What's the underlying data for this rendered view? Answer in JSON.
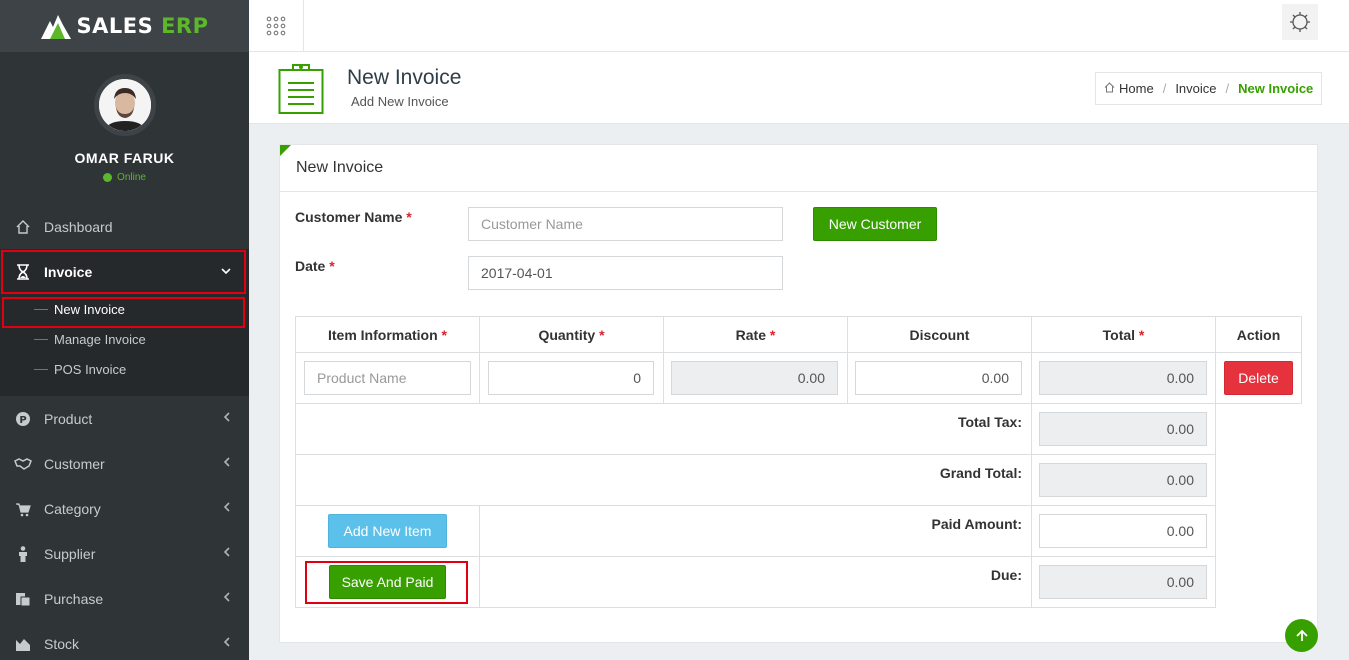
{
  "brand": {
    "name": "SALES",
    "suffix": "ERP"
  },
  "user": {
    "name": "OMAR FARUK",
    "status": "Online"
  },
  "sidebar": {
    "items": [
      {
        "label": "Dashboard",
        "icon": "home-icon"
      },
      {
        "label": "Invoice",
        "icon": "hourglass-icon"
      },
      {
        "label": "Product",
        "icon": "product-icon"
      },
      {
        "label": "Customer",
        "icon": "handshake-icon"
      },
      {
        "label": "Category",
        "icon": "cart-icon"
      },
      {
        "label": "Supplier",
        "icon": "person-icon"
      },
      {
        "label": "Purchase",
        "icon": "purchase-icon"
      },
      {
        "label": "Stock",
        "icon": "chart-icon"
      }
    ],
    "invoice_sub": [
      "New Invoice",
      "Manage Invoice",
      "POS Invoice"
    ]
  },
  "header": {
    "title": "New Invoice",
    "subtitle": "Add New Invoice",
    "breadcrumb": [
      "Home",
      "Invoice",
      "New Invoice"
    ]
  },
  "panel": {
    "title": "New Invoice"
  },
  "form": {
    "customer_label": "Customer Name",
    "customer_placeholder": "Customer Name",
    "new_customer_button": "New Customer",
    "date_label": "Date",
    "date_value": "2017-04-01",
    "required_mark": "*"
  },
  "table": {
    "headers": [
      "Item Information",
      "Quantity",
      "Rate",
      "Discount",
      "Total",
      "Action"
    ],
    "row": {
      "product_placeholder": "Product Name",
      "quantity": "0",
      "rate": "0.00",
      "discount": "0.00",
      "total": "0.00",
      "delete_button": "Delete"
    },
    "total_tax_label": "Total Tax:",
    "total_tax": "0.00",
    "grand_total_label": "Grand Total:",
    "grand_total": "0.00",
    "paid_amount_label": "Paid Amount:",
    "paid_amount": "0.00",
    "due_label": "Due:",
    "due": "0.00",
    "add_item_button": "Add New Item",
    "save_button": "Save And Paid"
  },
  "colors": {
    "accent": "#37a000",
    "sidebar": "#2f3437",
    "danger": "#e5323d",
    "info": "#5bc0ea"
  }
}
